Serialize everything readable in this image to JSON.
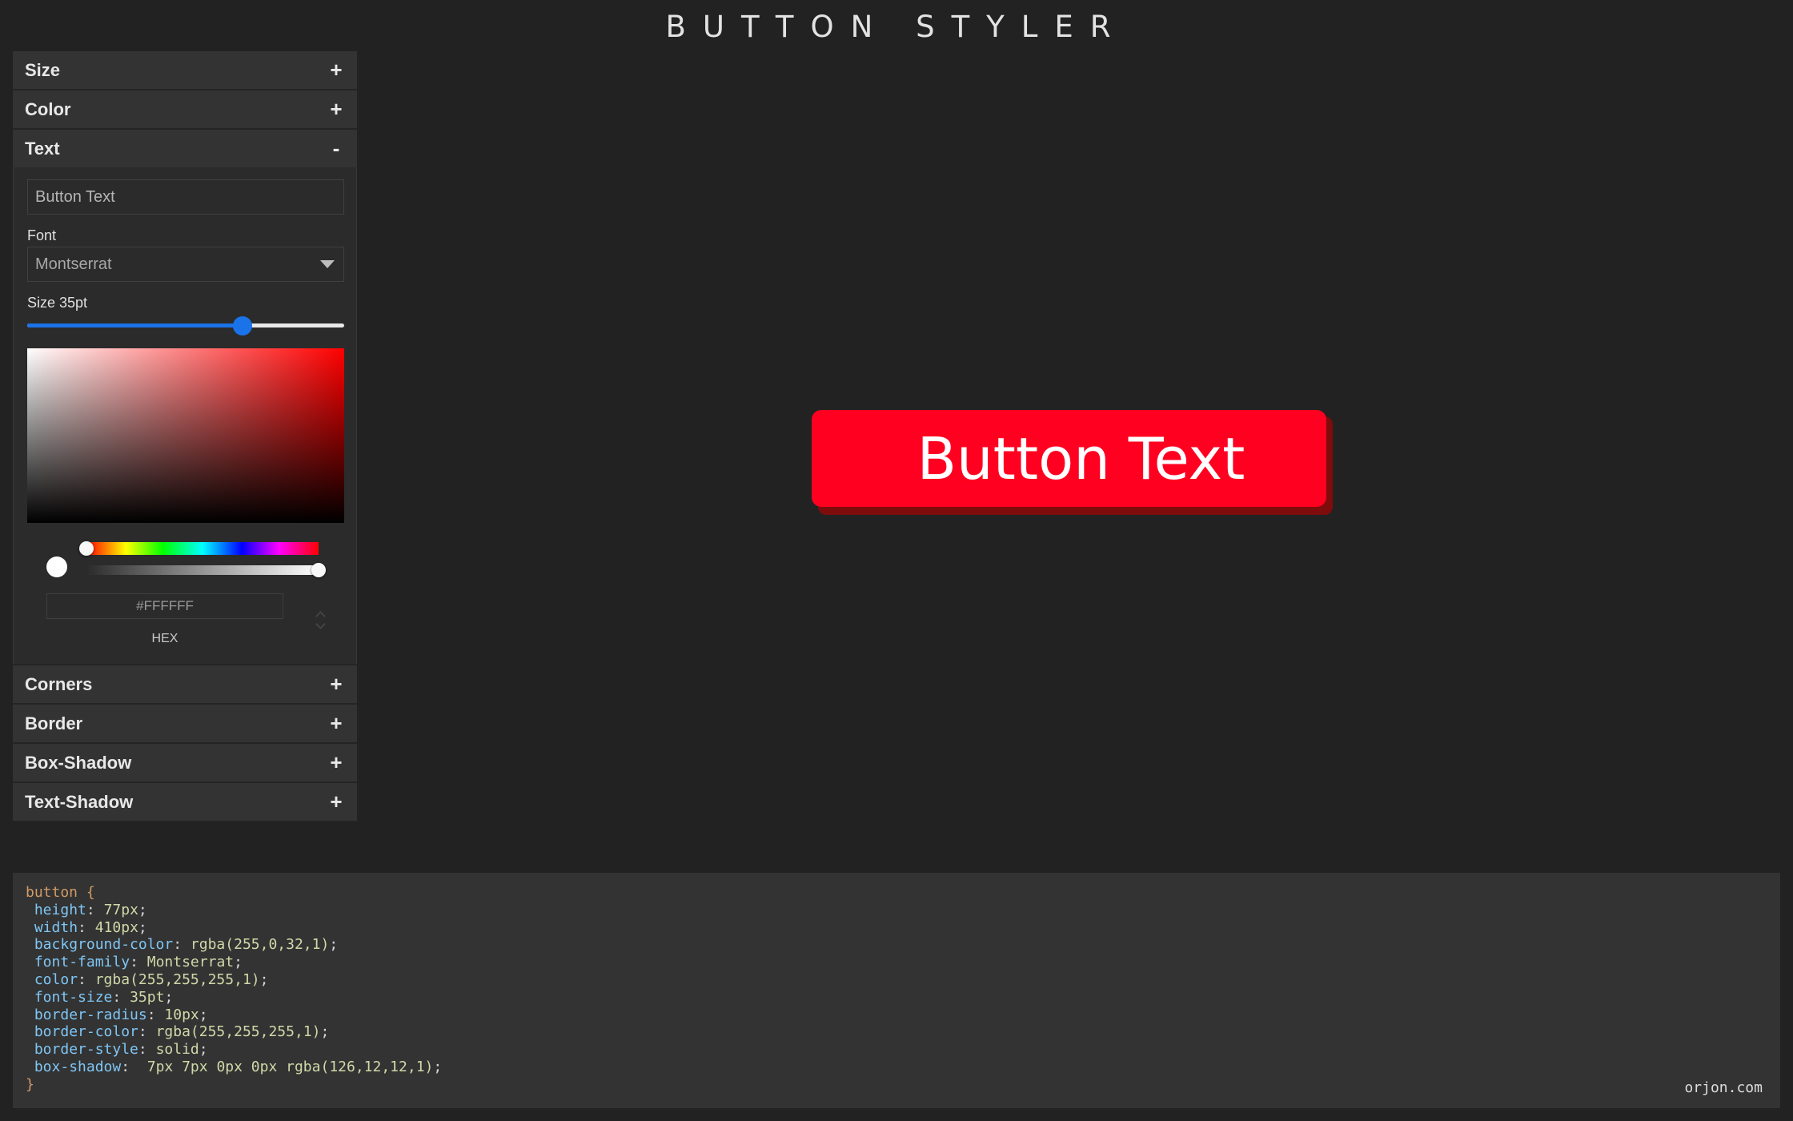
{
  "title": "BUTTON STYLER",
  "sections": {
    "size": {
      "label": "Size",
      "toggle": "+"
    },
    "color": {
      "label": "Color",
      "toggle": "+"
    },
    "text": {
      "label": "Text",
      "toggle": "-",
      "text_value": "Button Text",
      "font_label": "Font",
      "font_value": "Montserrat",
      "size_label": "Size 35pt",
      "size_slider_fraction": 0.68,
      "hex_value": "#FFFFFF",
      "hex_label": "HEX",
      "hue_fraction": 0.0,
      "alpha_fraction": 1.0,
      "swatch_color": "#FFFFFF"
    },
    "corners": {
      "label": "Corners",
      "toggle": "+"
    },
    "border": {
      "label": "Border",
      "toggle": "+"
    },
    "box_shadow": {
      "label": "Box-Shadow",
      "toggle": "+"
    },
    "text_shadow": {
      "label": "Text-Shadow",
      "toggle": "+"
    }
  },
  "preview": {
    "text": "Button Text",
    "background": "#FF0020",
    "shadow_color": "#7E0C0C",
    "text_color": "#FFFFFF"
  },
  "code": {
    "selector": "button",
    "open_brace": "{",
    "close_brace": "}",
    "lines": [
      {
        "prop": "height",
        "value": "77px"
      },
      {
        "prop": "width",
        "value": "410px"
      },
      {
        "prop": "background-color",
        "value": "rgba(255,0,32,1)"
      },
      {
        "prop": "font-family",
        "value": "Montserrat"
      },
      {
        "prop": "color",
        "value": "rgba(255,255,255,1)"
      },
      {
        "prop": "font-size",
        "value": "35pt"
      },
      {
        "prop": "border-radius",
        "value": "10px"
      },
      {
        "prop": "border-color",
        "value": "rgba(255,255,255,1)"
      },
      {
        "prop": "border-style",
        "value": "solid"
      },
      {
        "prop": "box-shadow",
        "value": " 7px 7px 0px 0px rgba(126,12,12,1)"
      }
    ]
  },
  "credit": "orjon.com",
  "icons": {
    "font_dropdown": "chevron-down-icon",
    "hex_switch": "up-down-arrows-icon"
  }
}
